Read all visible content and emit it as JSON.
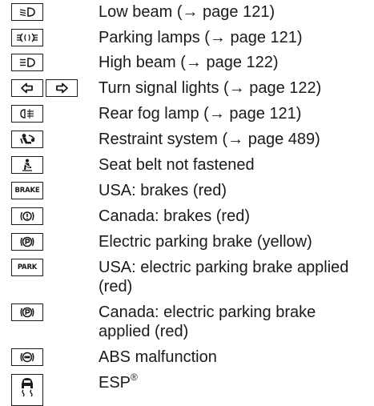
{
  "entries": [
    {
      "icons": [
        "low-beam-icon"
      ],
      "label": "Low beam (→ page 121)"
    },
    {
      "icons": [
        "parking-lamps-icon"
      ],
      "label": "Parking lamps (→ page 121)"
    },
    {
      "icons": [
        "high-beam-icon"
      ],
      "label": "High beam (→ page 122)"
    },
    {
      "icons": [
        "turn-left-arrow-icon",
        "turn-right-arrow-icon"
      ],
      "label": "Turn signal lights (→ page 122)"
    },
    {
      "icons": [
        "rear-fog-lamp-icon"
      ],
      "label": "Rear fog lamp (→ page 121)"
    },
    {
      "icons": [
        "restraint-system-icon"
      ],
      "label": "Restraint system (→ page 489)"
    },
    {
      "icons": [
        "seat-belt-icon"
      ],
      "label": "Seat belt not fastened"
    },
    {
      "icons": [
        "brake-text-icon"
      ],
      "icon_text": "BRAKE",
      "label": "USA: brakes (red)"
    },
    {
      "icons": [
        "brake-warning-circle-icon"
      ],
      "label": "Canada: brakes (red)"
    },
    {
      "icons": [
        "parking-brake-circle-icon"
      ],
      "label": "Electric parking brake (yellow)"
    },
    {
      "icons": [
        "park-text-icon"
      ],
      "icon_text": "PARK",
      "label": "USA: electric parking brake applied (red)"
    },
    {
      "icons": [
        "parking-brake-circle-icon"
      ],
      "label": "Canada: electric parking brake applied (red)"
    },
    {
      "icons": [
        "abs-icon"
      ],
      "label": "ABS malfunction"
    },
    {
      "icons": [
        "esp-skid-icon"
      ],
      "label": "ESP",
      "label_sup": "®"
    }
  ]
}
